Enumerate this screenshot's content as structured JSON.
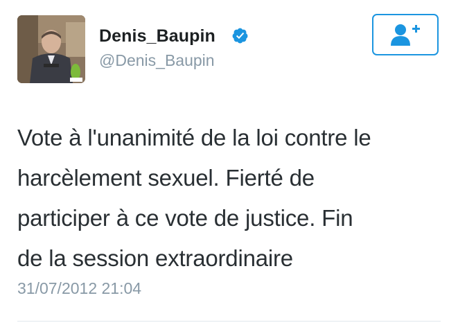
{
  "author": {
    "display_name": "Denis_Baupin",
    "handle": "@Denis_Baupin",
    "verified": true,
    "avatar_icon": "profile-photo"
  },
  "follow_button": {
    "icon": "add-user-icon",
    "accent_color": "#1b95e0"
  },
  "tweet": {
    "lines": [
      "Vote à l'unanimité de la loi contre le",
      "harcèlement sexuel. Fierté de",
      "participer à ce vote de justice. Fin",
      "de la session extraordinaire"
    ],
    "timestamp": "31/07/2012 21:04"
  },
  "colors": {
    "text": "#292f33",
    "secondary": "#8899a6",
    "verified_badge": "#1b95e0",
    "divider": "#e1e8ed"
  }
}
